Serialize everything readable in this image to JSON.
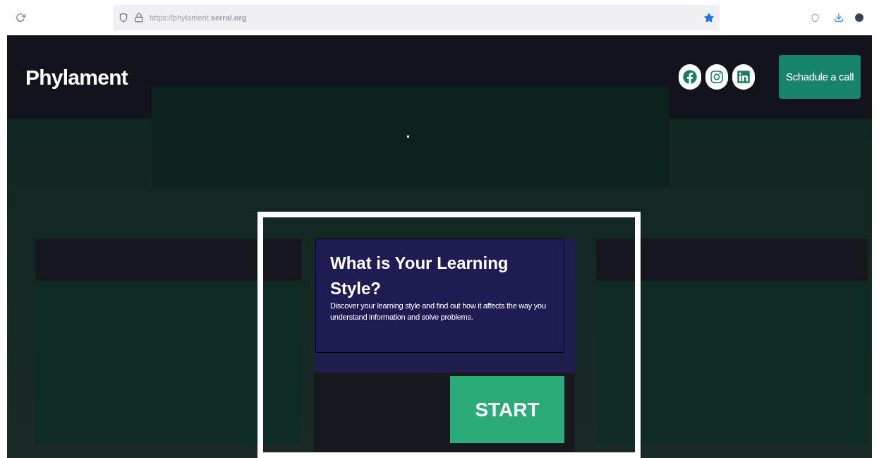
{
  "browser": {
    "url": "https://phylament.**serral.org**",
    "bookmarked": true
  },
  "header": {
    "logo": "Phylament",
    "social_links": [
      {
        "kind": "facebook"
      },
      {
        "kind": "instagram"
      },
      {
        "kind": "linkedin"
      }
    ],
    "cta": "Schadule a call"
  },
  "quiz_card": {
    "title": "What is Your Learning Style?",
    "description": "Discover your learning style and find out how it affects the way you understand information and solve problems.",
    "button": "START"
  }
}
